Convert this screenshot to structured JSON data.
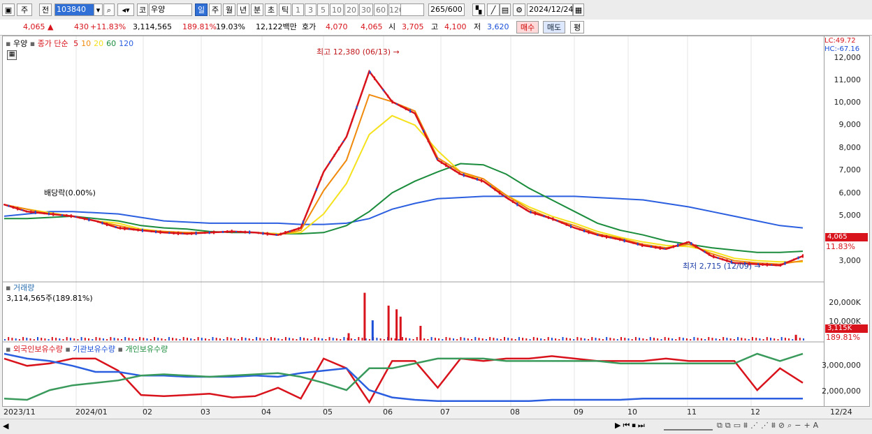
{
  "toolbar": {
    "type_btn": "주",
    "prev_btn": "전",
    "code": "103840",
    "market": "코",
    "name": "우양",
    "periods": [
      "일",
      "주",
      "월",
      "년",
      "분",
      "초",
      "틱"
    ],
    "active_period": "일",
    "numbers": [
      "1",
      "3",
      "5",
      "10",
      "20",
      "30",
      "60",
      "120"
    ],
    "count": "265",
    "count_total": "/600",
    "date": "2024/12/24"
  },
  "quote": {
    "price": "4,065",
    "arrow": "▲",
    "change": "430",
    "change_pct": "+11.83%",
    "volume": "3,114,565",
    "volume_ratio": "189.81%",
    "turnover": "19.03%",
    "amount": "12,122백만",
    "ask_label": "호가",
    "ask": "4,070",
    "bid": "4,065",
    "open_label": "시",
    "open": "3,705",
    "high_label": "고",
    "high": "4,100",
    "low_label": "저",
    "low": "3,620",
    "buy_btn": "매수",
    "sell_btn": "매도",
    "eval_btn": "평"
  },
  "price_panel": {
    "name_tag": "우양",
    "legend_close": "종가 단순",
    "ma_labels": [
      "5",
      "10",
      "20",
      "60",
      "120"
    ],
    "ma_colors": [
      "#d8131c",
      "#f08a0c",
      "#f5e11c",
      "#1a8c3c",
      "#2b5fe0"
    ],
    "annotation_high": "최고 12,380 (06/13)",
    "annotation_low": "최저 2,715 (12/09)",
    "dividend": "배당락(0.00%)",
    "lc": "LC:49.72",
    "hc": "HC:-67.16",
    "y_ticks": [
      "12,000",
      "11,000",
      "10,000",
      "9,000",
      "8,000",
      "7,000",
      "6,000",
      "5,000",
      "3,000"
    ],
    "last_price_tag": "4,065",
    "last_pct_tag": "11.83%"
  },
  "volume_panel": {
    "title": "거래량",
    "value": "3,114,565주(189.81%)",
    "y_ticks": [
      "20,000K",
      "10,000K"
    ],
    "last_tag": "3,115K",
    "last_pct": "189.81%"
  },
  "holdings_panel": {
    "legend": [
      "외국인보유수량",
      "기관보유수량",
      "개인보유수량"
    ],
    "y_ticks": [
      "3,000,000",
      "2,000,000"
    ]
  },
  "x_axis": [
    "2023/11",
    "2024/01",
    "02",
    "03",
    "04",
    "05",
    "06",
    "07",
    "08",
    "09",
    "10",
    "11",
    "12",
    "12/24"
  ],
  "chart_data": {
    "type": "line",
    "title": "",
    "price_series": [
      {
        "name": "5",
        "values": [
          5.6,
          5.3,
          5.2,
          5.1,
          4.9,
          4.6,
          4.5,
          4.4,
          4.35,
          4.4,
          4.45,
          4.4,
          4.3,
          4.6,
          7.0,
          8.5,
          11.3,
          10.0,
          9.5,
          7.5,
          6.9,
          6.6,
          5.9,
          5.3,
          5.0,
          4.6,
          4.3,
          4.1,
          3.85,
          3.7,
          4.0,
          3.4,
          3.1,
          3.05,
          3.0,
          3.4
        ]
      },
      {
        "name": "10",
        "values": [
          5.6,
          5.4,
          5.2,
          5.1,
          4.9,
          4.7,
          4.5,
          4.45,
          4.4,
          4.4,
          4.45,
          4.4,
          4.3,
          4.5,
          6.2,
          7.5,
          10.3,
          10.0,
          9.6,
          7.6,
          7.0,
          6.7,
          6.0,
          5.4,
          5.0,
          4.7,
          4.35,
          4.15,
          3.9,
          3.75,
          3.9,
          3.5,
          3.2,
          3.1,
          3.05,
          3.2
        ]
      },
      {
        "name": "20",
        "values": [
          5.6,
          5.4,
          5.25,
          5.1,
          4.9,
          4.8,
          4.55,
          4.45,
          4.4,
          4.4,
          4.45,
          4.4,
          4.35,
          4.4,
          5.2,
          6.5,
          8.6,
          9.4,
          9.0,
          7.9,
          7.0,
          6.6,
          6.0,
          5.5,
          5.1,
          4.8,
          4.45,
          4.2,
          4.0,
          3.85,
          3.8,
          3.6,
          3.3,
          3.2,
          3.15,
          3.15
        ]
      },
      {
        "name": "60",
        "values": [
          5.0,
          5.0,
          5.05,
          5.1,
          5.0,
          4.9,
          4.7,
          4.6,
          4.55,
          4.45,
          4.4,
          4.4,
          4.35,
          4.35,
          4.4,
          4.7,
          5.3,
          6.1,
          6.6,
          7.0,
          7.35,
          7.3,
          6.9,
          6.3,
          5.8,
          5.3,
          4.8,
          4.5,
          4.3,
          4.05,
          3.9,
          3.75,
          3.65,
          3.55,
          3.55,
          3.6
        ]
      },
      {
        "name": "120",
        "values": [
          5.1,
          5.2,
          5.3,
          5.3,
          5.25,
          5.2,
          5.05,
          4.9,
          4.85,
          4.8,
          4.8,
          4.8,
          4.8,
          4.75,
          4.75,
          4.8,
          5.0,
          5.4,
          5.65,
          5.85,
          5.9,
          5.95,
          5.95,
          5.95,
          5.95,
          5.95,
          5.9,
          5.85,
          5.8,
          5.65,
          5.5,
          5.3,
          5.1,
          4.9,
          4.7,
          4.6
        ]
      }
    ],
    "price_ylim": [
      2.5,
      12.5
    ],
    "volume_spikes_k": [
      {
        "x": 0.43,
        "v": 4000
      },
      {
        "x": 0.45,
        "v": 26000
      },
      {
        "x": 0.46,
        "v": 11000
      },
      {
        "x": 0.48,
        "v": 19000
      },
      {
        "x": 0.49,
        "v": 17000
      },
      {
        "x": 0.495,
        "v": 13000
      },
      {
        "x": 0.52,
        "v": 8000
      },
      {
        "x": 0.99,
        "v": 3115
      }
    ],
    "holdings": [
      {
        "name": "외국인보유수량",
        "values": [
          3.3,
          3.0,
          3.1,
          3.3,
          3.3,
          2.8,
          1.8,
          1.75,
          1.8,
          1.85,
          1.7,
          1.75,
          2.1,
          1.65,
          3.3,
          2.9,
          1.5,
          3.2,
          3.2,
          2.1,
          3.3,
          3.2,
          3.3,
          3.3,
          3.4,
          3.3,
          3.2,
          3.2,
          3.2,
          3.3,
          3.2,
          3.2,
          3.2,
          2.0,
          2.9,
          2.3
        ]
      },
      {
        "name": "기관보유수량",
        "values": [
          3.5,
          3.3,
          3.2,
          3.0,
          2.75,
          2.75,
          2.6,
          2.6,
          2.55,
          2.55,
          2.55,
          2.6,
          2.55,
          2.7,
          2.8,
          2.9,
          2.0,
          1.7,
          1.6,
          1.55,
          1.55,
          1.55,
          1.55,
          1.55,
          1.6,
          1.6,
          1.6,
          1.6,
          1.65,
          1.65,
          1.65,
          1.65,
          1.65,
          1.65,
          1.65,
          1.65
        ]
      },
      {
        "name": "개인보유수량",
        "values": [
          1.65,
          1.6,
          2.0,
          2.2,
          2.3,
          2.4,
          2.6,
          2.65,
          2.6,
          2.55,
          2.6,
          2.65,
          2.7,
          2.55,
          2.3,
          2.0,
          2.9,
          2.9,
          3.1,
          3.3,
          3.3,
          3.3,
          3.2,
          3.2,
          3.2,
          3.2,
          3.2,
          3.1,
          3.1,
          3.1,
          3.1,
          3.1,
          3.1,
          3.5,
          3.2,
          3.5
        ]
      }
    ],
    "holdings_ylim": [
      1.4,
      3.7
    ]
  }
}
